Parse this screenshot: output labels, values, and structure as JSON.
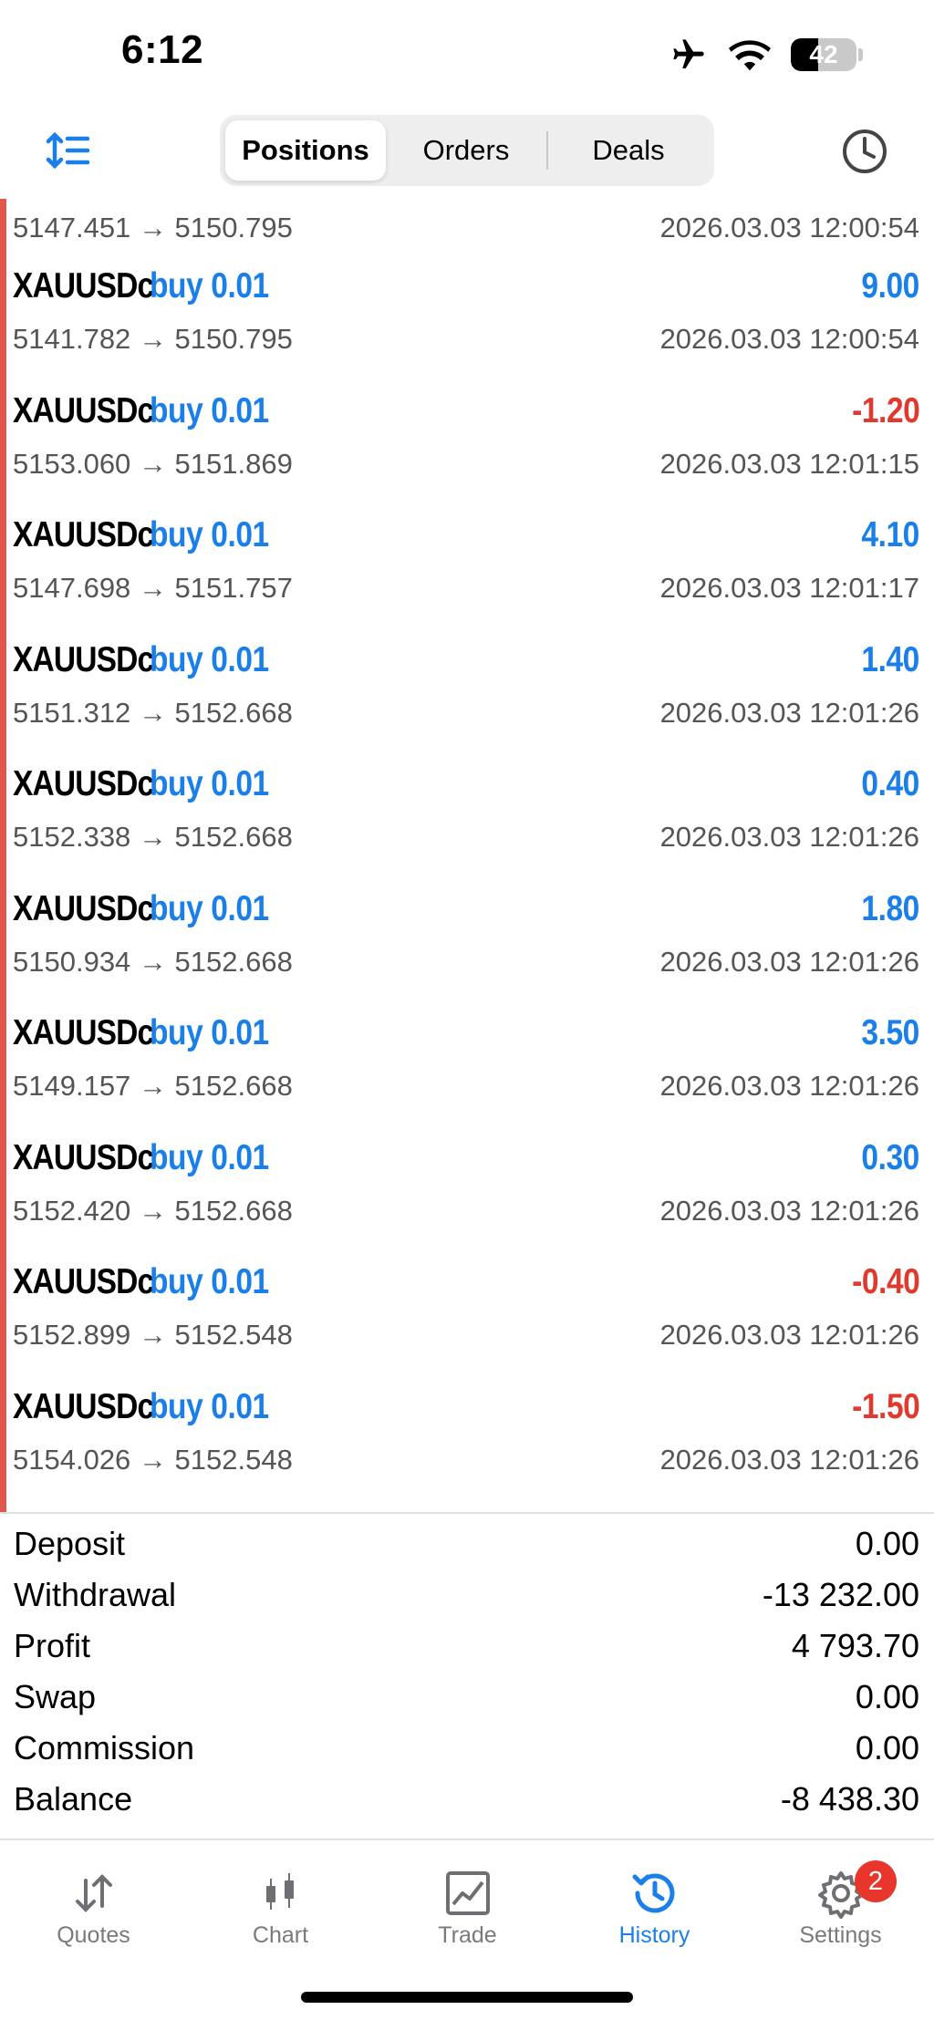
{
  "status_bar": {
    "time": "6:12",
    "battery": "42",
    "battery_level": 0.42
  },
  "toolbar": {
    "tabs": [
      {
        "label": "Positions",
        "active": true
      },
      {
        "label": "Orders",
        "active": false
      },
      {
        "label": "Deals",
        "active": false
      }
    ]
  },
  "colors": {
    "accent": "#1a7fe8",
    "loss": "#e03a2f",
    "side_bar": "#e2574c"
  },
  "partial_row": {
    "prices": "5147.451 → 5150.795",
    "time": "2026.03.03 12:00:54"
  },
  "rows": [
    {
      "symbol": "XAUUSDc",
      "type": "buy 0.01",
      "profit": "9.00",
      "profit_sign": "positive",
      "prices": "5141.782 → 5150.795",
      "time": "2026.03.03 12:00:54"
    },
    {
      "symbol": "XAUUSDc",
      "type": "buy 0.01",
      "profit": "-1.20",
      "profit_sign": "negative",
      "prices": "5153.060 → 5151.869",
      "time": "2026.03.03 12:01:15"
    },
    {
      "symbol": "XAUUSDc",
      "type": "buy 0.01",
      "profit": "4.10",
      "profit_sign": "positive",
      "prices": "5147.698 → 5151.757",
      "time": "2026.03.03 12:01:17"
    },
    {
      "symbol": "XAUUSDc",
      "type": "buy 0.01",
      "profit": "1.40",
      "profit_sign": "positive",
      "prices": "5151.312 → 5152.668",
      "time": "2026.03.03 12:01:26"
    },
    {
      "symbol": "XAUUSDc",
      "type": "buy 0.01",
      "profit": "0.40",
      "profit_sign": "positive",
      "prices": "5152.338 → 5152.668",
      "time": "2026.03.03 12:01:26"
    },
    {
      "symbol": "XAUUSDc",
      "type": "buy 0.01",
      "profit": "1.80",
      "profit_sign": "positive",
      "prices": "5150.934 → 5152.668",
      "time": "2026.03.03 12:01:26"
    },
    {
      "symbol": "XAUUSDc",
      "type": "buy 0.01",
      "profit": "3.50",
      "profit_sign": "positive",
      "prices": "5149.157 → 5152.668",
      "time": "2026.03.03 12:01:26"
    },
    {
      "symbol": "XAUUSDc",
      "type": "buy 0.01",
      "profit": "0.30",
      "profit_sign": "positive",
      "prices": "5152.420 → 5152.668",
      "time": "2026.03.03 12:01:26"
    },
    {
      "symbol": "XAUUSDc",
      "type": "buy 0.01",
      "profit": "-0.40",
      "profit_sign": "negative",
      "prices": "5152.899 → 5152.548",
      "time": "2026.03.03 12:01:26"
    },
    {
      "symbol": "XAUUSDc",
      "type": "buy 0.01",
      "profit": "-1.50",
      "profit_sign": "negative",
      "prices": "5154.026 → 5152.548",
      "time": "2026.03.03 12:01:26"
    }
  ],
  "summary": [
    {
      "label": "Deposit",
      "value": "0.00"
    },
    {
      "label": "Withdrawal",
      "value": "-13 232.00"
    },
    {
      "label": "Profit",
      "value": "4 793.70"
    },
    {
      "label": "Swap",
      "value": "0.00"
    },
    {
      "label": "Commission",
      "value": "0.00"
    },
    {
      "label": "Balance",
      "value": "-8 438.30"
    }
  ],
  "tabbar": {
    "items": [
      {
        "label": "Quotes",
        "icon": "quotes-arrows-icon",
        "active": false
      },
      {
        "label": "Chart",
        "icon": "candlestick-chart-icon",
        "active": false
      },
      {
        "label": "Trade",
        "icon": "trade-chart-icon",
        "active": false
      },
      {
        "label": "History",
        "icon": "history-clock-icon",
        "active": true
      },
      {
        "label": "Settings",
        "icon": "gear-icon",
        "active": false,
        "badge": "2"
      }
    ]
  }
}
